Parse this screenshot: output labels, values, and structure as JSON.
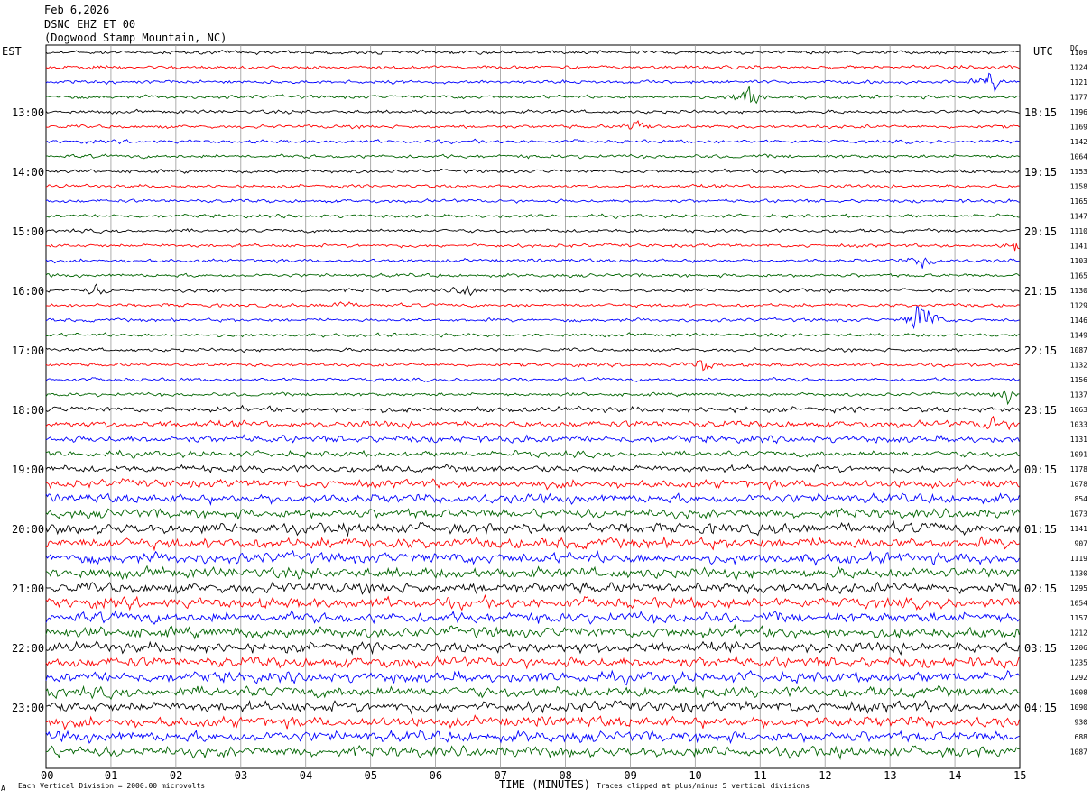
{
  "header": {
    "date": "Feb 6,2026",
    "station": "DSNC EHZ ET 00",
    "location": "(Dogwood Stamp Mountain, NC)"
  },
  "left_tz": "EST",
  "right_tz": "UTC",
  "dc_label": "DC",
  "footer": {
    "scale_note": "Each Vertical Division = 2000.00 microvolts",
    "xlabel": "TIME (MINUTES)",
    "clip_note": "Traces clipped at plus/minus 5 vertical divisions",
    "corner_mark": "A"
  },
  "chart_data": {
    "type": "line",
    "title": "DSNC EHZ ET 00 (Dogwood Stamp Mountain, NC) Feb 6,2026",
    "xlabel": "TIME (MINUTES)",
    "xlim": [
      0,
      15
    ],
    "x_ticks": [
      "00",
      "01",
      "02",
      "03",
      "04",
      "05",
      "06",
      "07",
      "08",
      "09",
      "10",
      "11",
      "12",
      "13",
      "14",
      "15"
    ],
    "left_hour_labels": [
      "13:00",
      "14:00",
      "15:00",
      "16:00",
      "17:00",
      "18:00",
      "19:00",
      "20:00",
      "21:00",
      "22:00",
      "23:00"
    ],
    "right_hour_labels": [
      "18:15",
      "19:15",
      "20:15",
      "21:15",
      "22:15",
      "23:15",
      "00:15",
      "01:15",
      "02:15",
      "03:15",
      "04:15"
    ],
    "first_left_label_row": 4,
    "traces_per_hour": 4,
    "trace_colors": [
      "#000000",
      "#ff0000",
      "#0000ff",
      "#006400"
    ],
    "dc_offsets": [
      "1109",
      "1124",
      "1121",
      "1177",
      "1196",
      "1169",
      "1142",
      "1064",
      "1153",
      "1158",
      "1165",
      "1147",
      "1110",
      "1141",
      "1103",
      "1165",
      "1130",
      "1129",
      "1146",
      "1149",
      "1087",
      "1132",
      "1156",
      "1137",
      "1063",
      "1033",
      "1131",
      "1091",
      "1178",
      "1078",
      "854",
      "1073",
      "1141",
      "907",
      "1119",
      "1130",
      "1295",
      "1054",
      "1157",
      "1212",
      "1206",
      "1235",
      "1292",
      "1008",
      "1090",
      "930",
      "688",
      "1087"
    ],
    "trace_amplitude_level": [
      1,
      1,
      1,
      1,
      1,
      1,
      1,
      1,
      1,
      1,
      1,
      1,
      1,
      1,
      1,
      1,
      1,
      1,
      1,
      1,
      1,
      1,
      1,
      1,
      1.6,
      1.9,
      2,
      1.7,
      2,
      2.3,
      2.6,
      2.6,
      3,
      3,
      3,
      3,
      3,
      3,
      3,
      3,
      3,
      3,
      3,
      3,
      3,
      3,
      3,
      3
    ],
    "events": [
      {
        "trace": 3,
        "minute": 10.83,
        "level": 6
      },
      {
        "trace": 2,
        "minute": 14.55,
        "level": 4
      },
      {
        "trace": 5,
        "minute": 9.1,
        "level": 3
      },
      {
        "trace": 13,
        "minute": 14.95,
        "level": 3
      },
      {
        "trace": 14,
        "minute": 13.55,
        "level": 3
      },
      {
        "trace": 16,
        "minute": 0.75,
        "level": 2
      },
      {
        "trace": 16,
        "minute": 6.5,
        "level": 2.5
      },
      {
        "trace": 17,
        "minute": 4.5,
        "level": 2
      },
      {
        "trace": 18,
        "minute": 13.5,
        "level": 10
      },
      {
        "trace": 21,
        "minute": 10.1,
        "level": 3
      },
      {
        "trace": 23,
        "minute": 14.8,
        "level": 3
      },
      {
        "trace": 25,
        "minute": 14.6,
        "level": 3
      }
    ]
  }
}
